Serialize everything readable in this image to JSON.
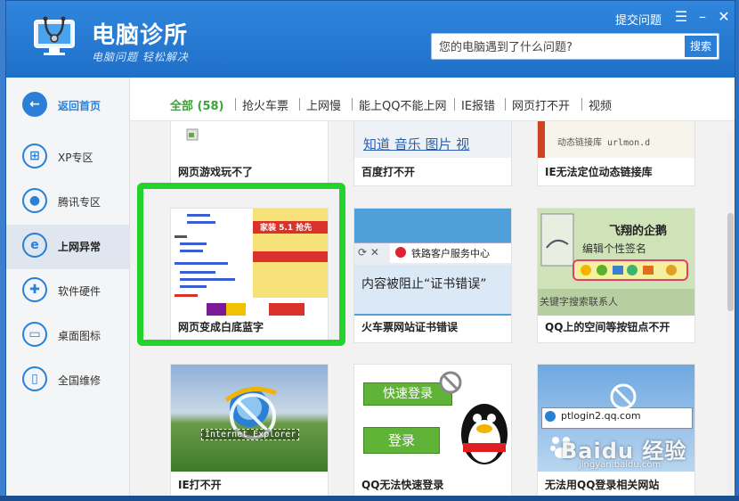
{
  "app": {
    "title": "电脑诊所",
    "slogan": "电脑问题 轻松解决",
    "ask_link": "提交问题",
    "menu_glyph": "☰",
    "min_glyph": "–",
    "close_glyph": "✕"
  },
  "search": {
    "placeholder": "您的电脑遇到了什么问题?",
    "button": "搜索"
  },
  "sidebar": {
    "items": [
      {
        "label": "返回首页",
        "icon": "back-arrow-icon",
        "glyph": "←"
      },
      {
        "label": "XP专区",
        "icon": "windows-icon",
        "glyph": "⊞"
      },
      {
        "label": "腾讯专区",
        "icon": "qq-penguin-icon",
        "glyph": "●"
      },
      {
        "label": "上网异常",
        "icon": "ie-icon",
        "glyph": "e"
      },
      {
        "label": "软件硬件",
        "icon": "puzzle-icon",
        "glyph": "✚"
      },
      {
        "label": "桌面图标",
        "icon": "monitor-icon",
        "glyph": "▭"
      },
      {
        "label": "全国维修",
        "icon": "phone-icon",
        "glyph": "▯"
      }
    ]
  },
  "tabs": [
    {
      "label": "全部 (58)",
      "active": true
    },
    {
      "label": "抢火车票"
    },
    {
      "label": "上网慢"
    },
    {
      "label": "能上QQ不能上网"
    },
    {
      "label": "IE报错"
    },
    {
      "label": "网页打不开"
    },
    {
      "label": "视频"
    }
  ],
  "cards": [
    {
      "caption": "网页游戏玩不了"
    },
    {
      "caption": "百度打不开",
      "thumb_text": "知道  音乐  图片  视"
    },
    {
      "caption": "IE无法定位动态链接库",
      "thumb_text": "动态链接库 urlmon.d"
    },
    {
      "caption": "网页变成白底蓝字",
      "thumb_text": "家装 5.1 抢先"
    },
    {
      "caption": "火车票网站证书错误",
      "thumb_text": "铁路客户服务中心",
      "thumb_sub": "内容被阻止“证书错误”"
    },
    {
      "caption": "QQ上的空间等按钮点不开",
      "thumb_text": "飞翔的企鹅",
      "thumb_sub": "编辑个性签名",
      "thumb_foot": "关键字搜索联系人"
    },
    {
      "caption": "IE打不开",
      "thumb_text": "Internet Explorer"
    },
    {
      "caption": "QQ无法快速登录",
      "thumb_text": "快速登录",
      "thumb_sub": "登录"
    },
    {
      "caption": "无法用QQ登录相关网站",
      "thumb_text": "ptlogin2.qq.com"
    }
  ],
  "watermark": {
    "text": "Baidu 经验",
    "sub": "jingyan.baidu.com"
  },
  "colors": {
    "titlebar": "#1f6fc8",
    "accent": "#2a7fd6",
    "tab_active": "#39a535",
    "highlight": "#23d22a"
  }
}
